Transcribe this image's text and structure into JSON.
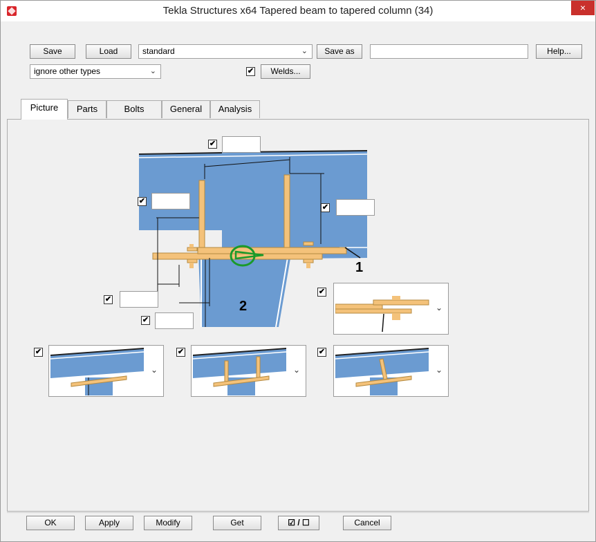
{
  "window": {
    "title": "Tekla Structures x64  Tapered beam to tapered column (34)",
    "close_label": "×"
  },
  "toolbar": {
    "save_label": "Save",
    "load_label": "Load",
    "preset_value": "standard",
    "save_as_label": "Save as",
    "save_as_value": "",
    "help_label": "Help...",
    "filter_value": "ignore other types",
    "welds_checked": "✔",
    "welds_label": "Welds..."
  },
  "tabs": [
    "Picture",
    "Parts",
    "Bolts",
    "General",
    "Analysis"
  ],
  "picture": {
    "label_1": "1",
    "label_2": "2",
    "check": "✔"
  },
  "footer": {
    "ok_label": "OK",
    "apply_label": "Apply",
    "modify_label": "Modify",
    "get_label": "Get",
    "toggle_label": "☑ / ☐",
    "cancel_label": "Cancel"
  },
  "colors": {
    "steel": "#6b9bd1",
    "plate": "#f4c27a",
    "weld": "#1a9a2a",
    "close": "#c9302c"
  }
}
